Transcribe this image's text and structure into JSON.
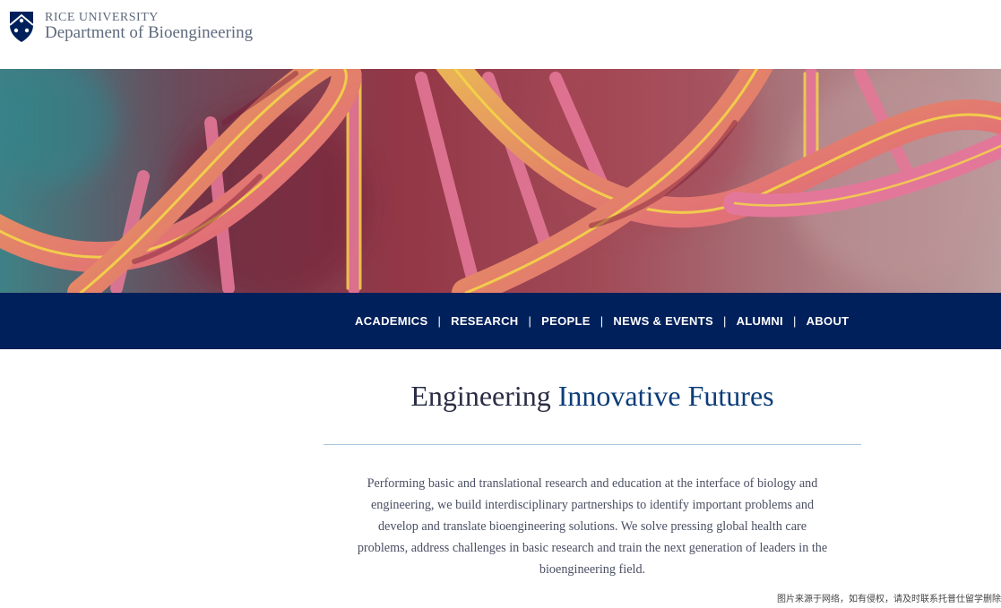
{
  "header": {
    "university": "RICE UNIVERSITY",
    "department": "Department of Bioengineering",
    "logo_icon": "rice-shield-icon"
  },
  "hero": {
    "image": "dna-double-helix",
    "colors": {
      "strand": "#f2a24a",
      "glow": "#ffe24d",
      "pink": "#f08aa0"
    }
  },
  "nav": {
    "items": [
      {
        "label": "ACADEMICS"
      },
      {
        "label": "RESEARCH"
      },
      {
        "label": "PEOPLE"
      },
      {
        "label": "NEWS & EVENTS"
      },
      {
        "label": "ALUMNI"
      },
      {
        "label": "ABOUT"
      }
    ],
    "separator": "|"
  },
  "main": {
    "headline_plain": "Engineering ",
    "headline_accent": "Innovative Futures",
    "description": "Performing basic and translational research and education at the interface of biology and engineering, we build interdisciplinary partnerships to identify important problems and develop and translate bioengineering solutions. We solve pressing global health care problems, address challenges in basic research and train the next generation of leaders in the bioengineering field."
  },
  "watermark": "图片来源于网络，如有侵权，请及时联系托普仕留学删除",
  "colors": {
    "nav_bg": "#00205b",
    "accent": "#0b3d7a",
    "divider": "#a9c6df",
    "heading": "#2a2e44",
    "body": "#4a4f63"
  }
}
